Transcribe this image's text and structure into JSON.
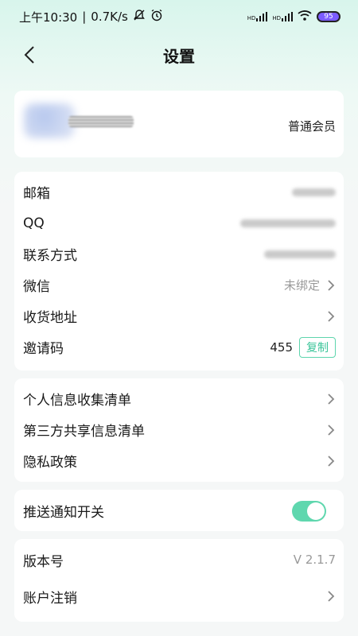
{
  "status_bar": {
    "time": "上午10:30",
    "network_speed": "0.7K/s",
    "signal1": "HD",
    "signal2": "HD",
    "battery": "95"
  },
  "nav": {
    "title": "设置"
  },
  "profile": {
    "membership": "普通会员"
  },
  "account": {
    "email_label": "邮箱",
    "qq_label": "QQ",
    "contact_label": "联系方式",
    "wechat_label": "微信",
    "wechat_value": "未绑定",
    "address_label": "收货地址",
    "invite_label": "邀请码",
    "invite_value": "455",
    "copy_label": "复制"
  },
  "privacy": {
    "personal_label": "个人信息收集清单",
    "third_party_label": "第三方共享信息清单",
    "policy_label": "隐私政策"
  },
  "notify": {
    "push_label": "推送通知开关",
    "push_enabled": true
  },
  "about": {
    "version_label": "版本号",
    "version_value": "V 2.1.7",
    "cancel_label": "账户注销"
  },
  "colors": {
    "accent": "#5fd7ae",
    "accent_text": "#3ac499"
  }
}
